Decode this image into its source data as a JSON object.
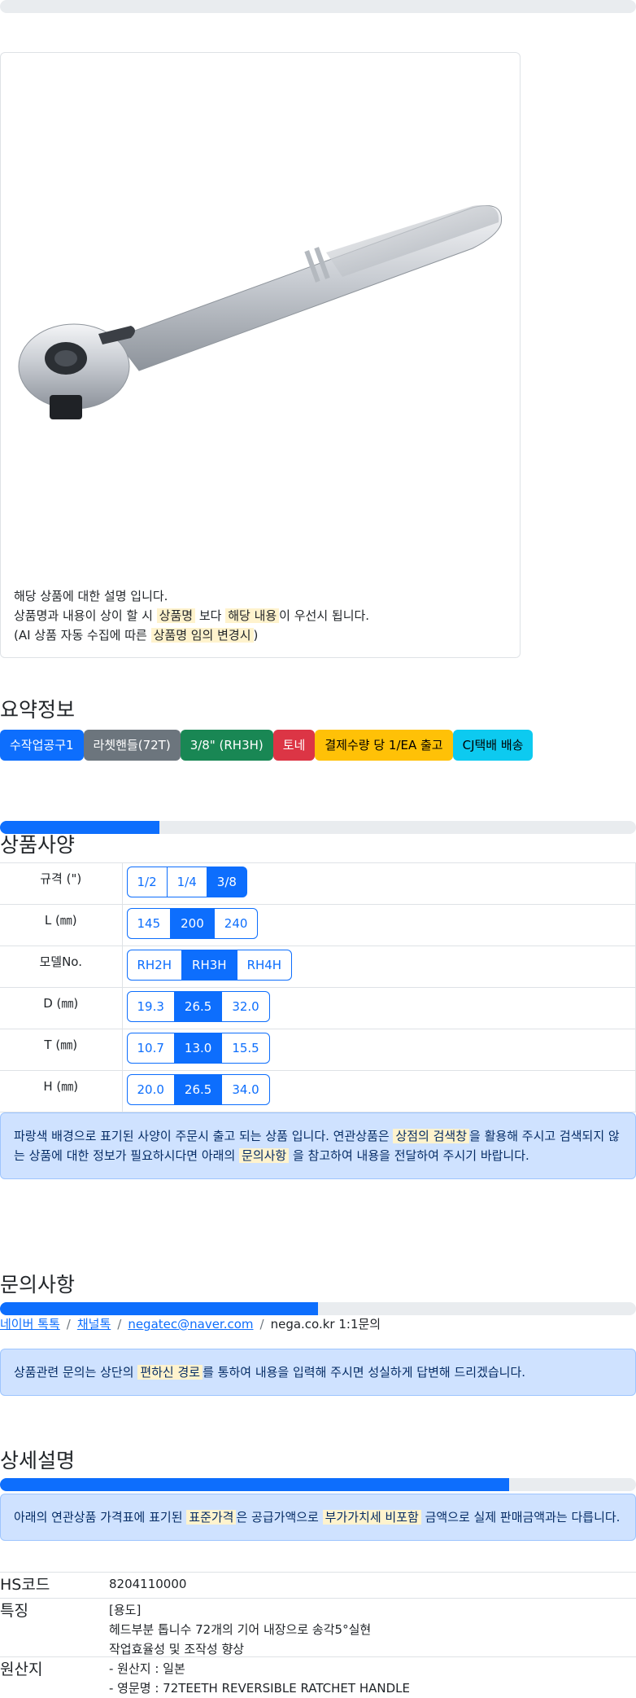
{
  "card": {
    "image_alt": "ratchet-handle-product-image",
    "caption": {
      "line1": "해당 상품에 대한 설명 입니다.",
      "line2_a": "상품명과 내용이 상이 할 시 ",
      "line2_mark1": "상품명",
      "line2_b": " 보다 ",
      "line2_mark2": "해당 내용",
      "line2_c": "이 우선시 됩니다.",
      "line3_a": "(AI 상품 자동 수집에 따른 ",
      "line3_mark": "상품명 임의 변경시",
      "line3_b": ")"
    }
  },
  "summary": {
    "title": "요약정보",
    "tags": [
      {
        "label": "수작업공구1",
        "color": "#0d6efd"
      },
      {
        "label": "라쳇핸들(72T)",
        "color": "#6c757d"
      },
      {
        "label": "3/8\" (RH3H)",
        "color": "#198754"
      },
      {
        "label": "토네",
        "color": "#dc3545"
      },
      {
        "label": "결제수량 당 1/EA 출고",
        "color": "#ffc107"
      },
      {
        "label": "CJ택배 배송",
        "color": "#0dcaf0"
      }
    ]
  },
  "specs": {
    "title": "상품사양",
    "progress": 0.25,
    "rows": [
      {
        "label": "규격 (\")",
        "options": [
          "1/2",
          "1/4",
          "3/8"
        ],
        "active": 2
      },
      {
        "label": "L (㎜)",
        "options": [
          "145",
          "200",
          "240"
        ],
        "active": 1
      },
      {
        "label": "모델No.",
        "options": [
          "RH2H",
          "RH3H",
          "RH4H"
        ],
        "active": 1
      },
      {
        "label": "D (㎜)",
        "options": [
          "19.3",
          "26.5",
          "32.0"
        ],
        "active": 1
      },
      {
        "label": "T (㎜)",
        "options": [
          "10.7",
          "13.0",
          "15.5"
        ],
        "active": 1
      },
      {
        "label": "H (㎜)",
        "options": [
          "20.0",
          "26.5",
          "34.0"
        ],
        "active": 1
      }
    ],
    "notice": {
      "a": "파랑색 배경으로 표기된 사양이 주문시 출고 되는 상품 입니다. 연관상품은 ",
      "mark1": "상점의 검색창",
      "b": "을 활용해 주시고 검색되지 않는 상품에 대한 정보가 필요하시다면 아래의 ",
      "mark2": "문의사항",
      "c": " 을 참고하여 내용을 전달하여 주시기 바랍니다."
    }
  },
  "inquiry": {
    "title": "문의사항",
    "progress": 0.5,
    "links": {
      "naver": "네이버 톡톡",
      "channel": "채널톡",
      "email": "negatec@naver.com",
      "site": "nega.co.kr 1:1문의",
      "sep": "/"
    },
    "notice": {
      "a": "상품관련 문의는 상단의 ",
      "mark": "편하신 경로",
      "b": "를 통하여 내용을 입력해 주시면 성실하게 답변해 드리겠습니다."
    }
  },
  "detail": {
    "title": "상세설명",
    "progress": 0.8,
    "notice": {
      "a": "아래의 연관상품 가격표에 표기된 ",
      "mark1": "표준가격",
      "b": "은 공급가액으로 ",
      "mark2": "부가가치세 비포함",
      "c": " 금액으로 실제 판매금액과는 다릅니다."
    },
    "rows": {
      "hs_key": "HS코드",
      "hs_val": "8204110000",
      "feature_key": "특징",
      "feature_lines": [
        "[용도]",
        "헤드부분 톱니수 72개의 기어 내장으로 송각5°실현",
        "작업효율성 및 조작성 향상"
      ],
      "origin_key": "원산지",
      "origin_lines": [
        "- 원산지 : 일본",
        "- 영문명 : 72TEETH REVERSIBLE RATCHET HANDLE"
      ]
    }
  }
}
